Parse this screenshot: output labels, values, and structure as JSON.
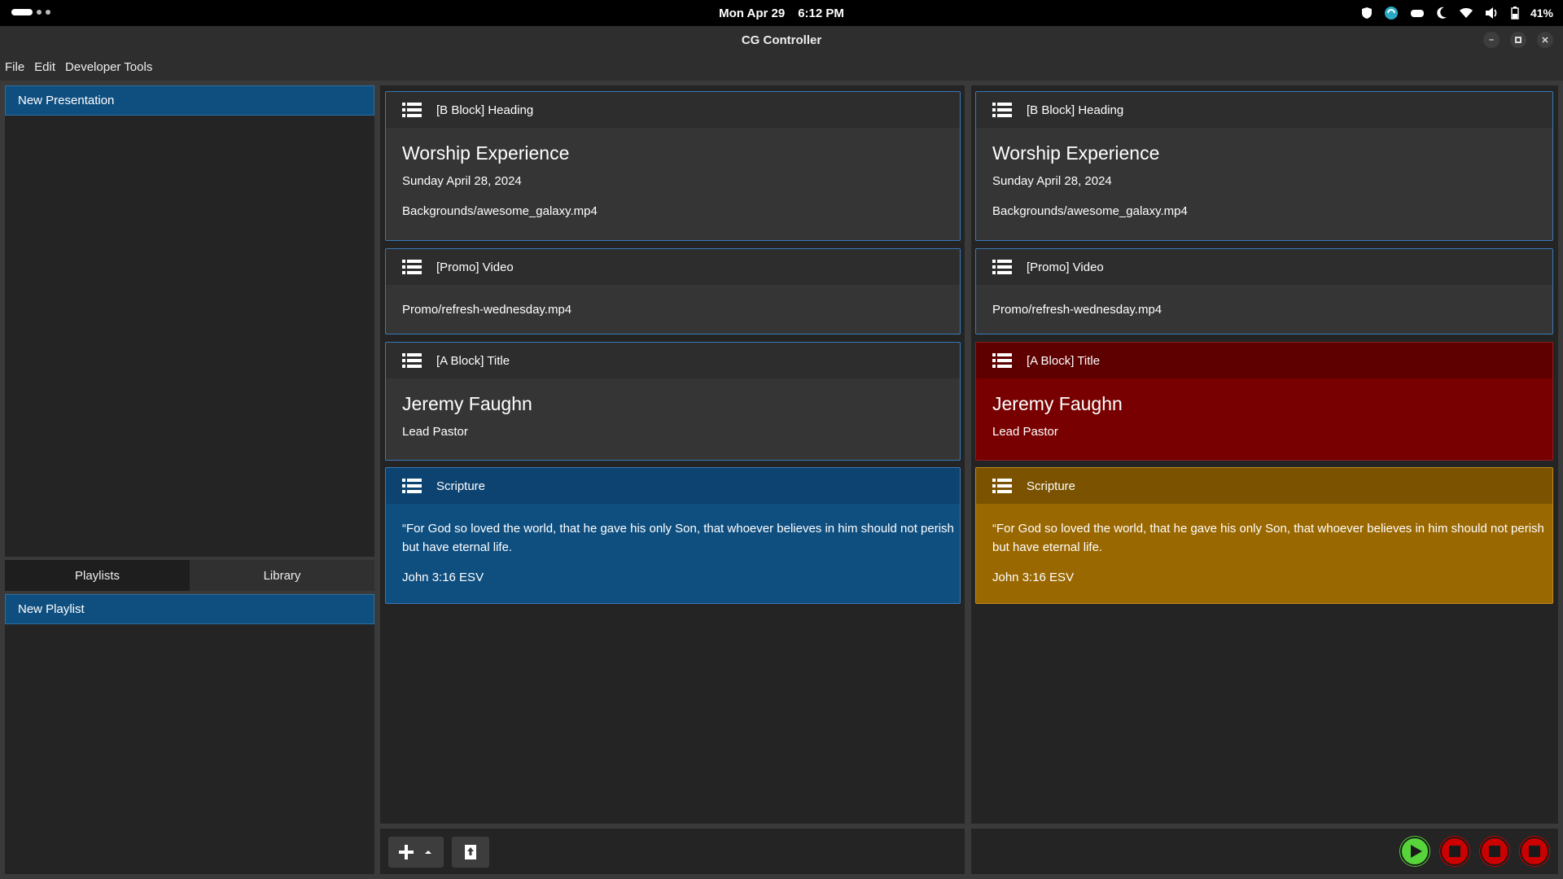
{
  "system_bar": {
    "date": "Mon Apr 29",
    "time": "6:12 PM",
    "battery": "41%"
  },
  "window": {
    "title": "CG Controller"
  },
  "menu": [
    "File",
    "Edit",
    "Developer Tools"
  ],
  "sidebar": {
    "presentation": "New Presentation",
    "tabs": [
      "Playlists",
      "Library"
    ],
    "active_tab": "Playlists",
    "playlist": "New Playlist"
  },
  "cards": [
    {
      "header": "[B Block] Heading",
      "title": "Worship Experience",
      "lines": [
        "Sunday April 28, 2024",
        "Backgrounds/awesome_galaxy.mp4"
      ]
    },
    {
      "header": "[Promo] Video",
      "lines": [
        "Promo/refresh-wednesday.mp4"
      ]
    },
    {
      "header": "[A Block] Title",
      "title": "Jeremy Faughn",
      "lines": [
        "Lead Pastor"
      ]
    },
    {
      "header": "Scripture",
      "lines": [
        "“For God so loved the world, that he gave his only Son, that whoever believes in him should not perish",
        "but have eternal life.",
        "John 3:16  ESV"
      ]
    }
  ],
  "colors": {
    "card_default": "#353535",
    "card_header_default": "#2d2d2d",
    "selected_blue": "#0f4f80",
    "live_red": "#780000",
    "live_red_header": "#5e0000",
    "next_gold": "#9a6800",
    "next_gold_header": "#7a5200",
    "play_green": "#57d43a",
    "stop_red": "#cc0000"
  },
  "icons": {
    "card": "list-icon",
    "add": "plus-icon",
    "export": "upload-icon",
    "play": "play-icon",
    "stop": "stop-icon"
  }
}
